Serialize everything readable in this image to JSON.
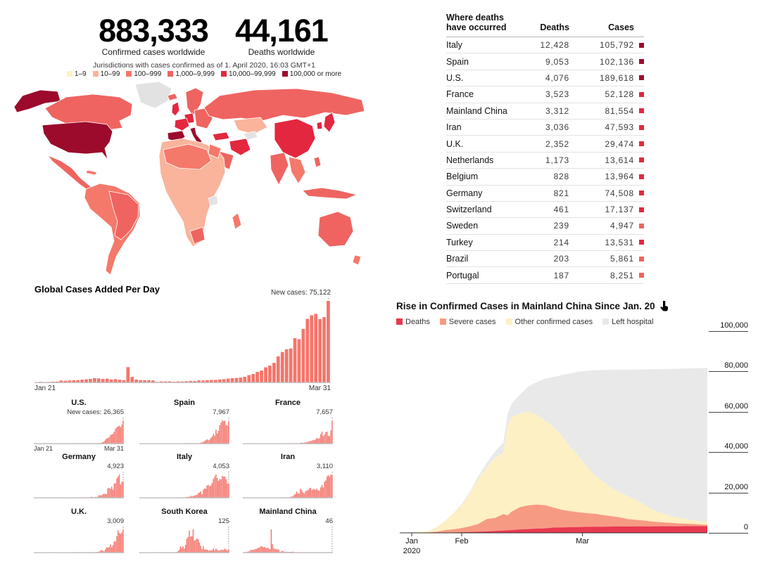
{
  "stats": {
    "confirmed": {
      "value": "883,333",
      "label": "Confirmed cases worldwide"
    },
    "deaths": {
      "value": "44,161",
      "label": "Deaths worldwide"
    }
  },
  "map": {
    "note": "Jurisdictions with cases confirmed as of 1. April 2020, 16:03 GMT+1",
    "no_data_color": "#e2e2e2",
    "legend": [
      {
        "label": "1–9",
        "color": "#fdf2c8"
      },
      {
        "label": "10–99",
        "color": "#f9b49b"
      },
      {
        "label": "100–999",
        "color": "#f4796b"
      },
      {
        "label": "1,000–9,999",
        "color": "#ef6460"
      },
      {
        "label": "10,000–99,999",
        "color": "#e3273f"
      },
      {
        "label": "100,000 or more",
        "color": "#9c0b2c"
      }
    ]
  },
  "palette": {
    "bar": "#f4756c",
    "axis": "#c4c4c4",
    "leader": "#8a8a8a"
  },
  "deaths_table": {
    "title_line1": "Where deaths",
    "title_line2": "have occurred",
    "col_deaths": "Deaths",
    "col_cases": "Cases",
    "rows": [
      {
        "country": "Italy",
        "deaths": "12,428",
        "cases": "105,792",
        "bucket": 5
      },
      {
        "country": "Spain",
        "deaths": "9,053",
        "cases": "102,136",
        "bucket": 5
      },
      {
        "country": "U.S.",
        "deaths": "4,076",
        "cases": "189,618",
        "bucket": 5
      },
      {
        "country": "France",
        "deaths": "3,523",
        "cases": "52,128",
        "bucket": 4
      },
      {
        "country": "Mainland China",
        "deaths": "3,312",
        "cases": "81,554",
        "bucket": 4
      },
      {
        "country": "Iran",
        "deaths": "3,036",
        "cases": "47,593",
        "bucket": 4
      },
      {
        "country": "U.K.",
        "deaths": "2,352",
        "cases": "29,474",
        "bucket": 4
      },
      {
        "country": "Netherlands",
        "deaths": "1,173",
        "cases": "13,614",
        "bucket": 4
      },
      {
        "country": "Belgium",
        "deaths": "828",
        "cases": "13,964",
        "bucket": 4
      },
      {
        "country": "Germany",
        "deaths": "821",
        "cases": "74,508",
        "bucket": 4
      },
      {
        "country": "Switzerland",
        "deaths": "461",
        "cases": "17,137",
        "bucket": 4
      },
      {
        "country": "Sweden",
        "deaths": "239",
        "cases": "4,947",
        "bucket": 3
      },
      {
        "country": "Turkey",
        "deaths": "214",
        "cases": "13,531",
        "bucket": 4
      },
      {
        "country": "Brazil",
        "deaths": "203",
        "cases": "5,861",
        "bucket": 3
      },
      {
        "country": "Portugal",
        "deaths": "187",
        "cases": "8,251",
        "bucket": 3
      }
    ]
  },
  "chart_data": [
    {
      "type": "bar",
      "id": "global",
      "title": "Global Cases Added Per Day",
      "annotation": "New cases: 75,122",
      "x_start": "Jan 21",
      "x_end": "Mar 31",
      "values": [
        314,
        581,
        266,
        472,
        698,
        785,
        1781,
        1477,
        1755,
        2005,
        2127,
        2603,
        2836,
        3239,
        3925,
        3721,
        3163,
        3437,
        2676,
        3001,
        2484,
        2022,
        14113,
        5109,
        2672,
        2162,
        2067,
        1998,
        1852,
        516,
        984,
        930,
        1035,
        648,
        988,
        929,
        1126,
        1420,
        1326,
        1850,
        1727,
        2024,
        2227,
        2306,
        2695,
        2995,
        3500,
        3900,
        4100,
        4500,
        5200,
        6700,
        7800,
        9700,
        10900,
        13900,
        15500,
        18000,
        24000,
        28000,
        30500,
        31300,
        40800,
        39800,
        49200,
        58600,
        61900,
        63200,
        58400,
        60100,
        75122
      ]
    },
    {
      "type": "bar",
      "id": "us",
      "title": "U.S.",
      "annotation": "New cases: 26,365",
      "x_start": "Jan 21",
      "x_end": "Mar 31",
      "values": [
        1,
        0,
        1,
        0,
        1,
        2,
        0,
        1,
        1,
        1,
        2,
        1,
        0,
        2,
        1,
        0,
        1,
        1,
        0,
        1,
        2,
        1,
        0,
        1,
        1,
        1,
        0,
        2,
        1,
        4,
        0,
        6,
        8,
        5,
        3,
        8,
        10,
        15,
        6,
        24,
        20,
        25,
        33,
        77,
        107,
        95,
        213,
        218,
        292,
        281,
        420,
        611,
        771,
        1018,
        1708,
        2526,
        4297,
        5594,
        6349,
        7304,
        9431,
        10301,
        11031,
        13525,
        16916,
        18691,
        19452,
        20342,
        18900,
        21700,
        26365
      ]
    },
    {
      "type": "bar",
      "id": "spain",
      "title": "Spain",
      "annotation": "7,967",
      "values": [
        0,
        0,
        0,
        0,
        0,
        0,
        0,
        0,
        0,
        0,
        0,
        1,
        0,
        0,
        0,
        0,
        0,
        0,
        0,
        0,
        0,
        0,
        0,
        0,
        0,
        0,
        0,
        0,
        0,
        0,
        0,
        0,
        0,
        0,
        2,
        8,
        13,
        27,
        34,
        49,
        36,
        30,
        37,
        57,
        60,
        119,
        117,
        174,
        373,
        400,
        615,
        869,
        1227,
        1522,
        1159,
        1438,
        1987,
        2538,
        3431,
        2833,
        4946,
        3646,
        4517,
        6584,
        7457,
        8271,
        7933,
        8189,
        6549,
        6398,
        7967
      ]
    },
    {
      "type": "bar",
      "id": "france",
      "title": "France",
      "annotation": "7,657",
      "values": [
        0,
        0,
        0,
        3,
        2,
        0,
        1,
        0,
        0,
        0,
        0,
        1,
        0,
        0,
        0,
        0,
        0,
        1,
        0,
        0,
        0,
        0,
        0,
        0,
        0,
        0,
        0,
        0,
        0,
        0,
        0,
        0,
        0,
        2,
        3,
        2,
        21,
        19,
        43,
        30,
        43,
        61,
        21,
        73,
        138,
        190,
        336,
        177,
        286,
        372,
        497,
        595,
        785,
        838,
        924,
        1210,
        1097,
        1404,
        1861,
        1617,
        1847,
        3176,
        3922,
        2446,
        2931,
        3809,
        3922,
        2599,
        2395,
        4376,
        7657
      ]
    },
    {
      "type": "bar",
      "id": "germany",
      "title": "Germany",
      "annotation": "4,923",
      "values": [
        0,
        0,
        0,
        0,
        0,
        0,
        1,
        2,
        1,
        0,
        1,
        2,
        0,
        1,
        1,
        1,
        0,
        1,
        0,
        0,
        1,
        0,
        0,
        1,
        0,
        0,
        0,
        2,
        0,
        0,
        0,
        0,
        0,
        2,
        2,
        2,
        3,
        9,
        27,
        23,
        29,
        28,
        39,
        66,
        138,
        284,
        163,
        55,
        237,
        157,
        271,
        802,
        693,
        733,
        1043,
        1174,
        1144,
        1042,
        2801,
        2958,
        2705,
        3311,
        2365,
        4183,
        4337,
        5780,
        6294,
        6922,
        3965,
        4751,
        4923
      ]
    },
    {
      "type": "bar",
      "id": "italy",
      "title": "Italy",
      "annotation": "4,053",
      "values": [
        0,
        0,
        0,
        0,
        0,
        0,
        0,
        0,
        0,
        2,
        1,
        0,
        0,
        0,
        0,
        0,
        0,
        0,
        0,
        0,
        0,
        0,
        0,
        0,
        0,
        0,
        0,
        0,
        0,
        0,
        0,
        17,
        42,
        93,
        74,
        93,
        131,
        202,
        233,
        240,
        566,
        342,
        466,
        587,
        769,
        778,
        1247,
        1492,
        1797,
        977,
        2313,
        2651,
        2547,
        3497,
        3590,
        3233,
        3526,
        4207,
        5322,
        5986,
        6557,
        5560,
        4789,
        5249,
        5210,
        6153,
        5959,
        5974,
        5217,
        4050,
        4053
      ]
    },
    {
      "type": "bar",
      "id": "iran",
      "title": "Iran",
      "annotation": "3,110",
      "values": [
        0,
        0,
        0,
        0,
        0,
        0,
        0,
        0,
        0,
        0,
        0,
        0,
        0,
        0,
        0,
        0,
        0,
        0,
        0,
        0,
        0,
        0,
        0,
        0,
        0,
        0,
        0,
        0,
        0,
        0,
        2,
        3,
        10,
        15,
        18,
        34,
        44,
        106,
        143,
        205,
        385,
        523,
        835,
        586,
        591,
        1234,
        1076,
        743,
        595,
        881,
        958,
        1075,
        1289,
        1365,
        1053,
        1178,
        1192,
        1046,
        1237,
        1028,
        966,
        1411,
        1762,
        1411,
        2206,
        2389,
        2926,
        3076,
        2901,
        3186,
        3110
      ]
    },
    {
      "type": "bar",
      "id": "uk",
      "title": "U.K.",
      "annotation": "3,009",
      "values": [
        0,
        0,
        0,
        0,
        0,
        0,
        0,
        0,
        0,
        0,
        2,
        0,
        0,
        1,
        0,
        0,
        0,
        1,
        0,
        0,
        0,
        0,
        0,
        0,
        0,
        0,
        0,
        0,
        0,
        3,
        0,
        2,
        0,
        4,
        1,
        5,
        3,
        13,
        4,
        11,
        12,
        4,
        12,
        34,
        29,
        48,
        45,
        69,
        43,
        62,
        77,
        130,
        208,
        342,
        251,
        152,
        407,
        680,
        643,
        714,
        1035,
        665,
        967,
        1427,
        1452,
        2129,
        2885,
        2546,
        2433,
        2619,
        3009
      ]
    },
    {
      "type": "bar",
      "id": "south_korea",
      "title": "South Korea",
      "annotation": "125",
      "values": [
        1,
        0,
        0,
        1,
        0,
        0,
        0,
        0,
        0,
        0,
        1,
        0,
        2,
        0,
        1,
        0,
        3,
        0,
        2,
        1,
        2,
        0,
        1,
        1,
        2,
        0,
        0,
        1,
        1,
        20,
        53,
        100,
        229,
        169,
        231,
        144,
        284,
        505,
        571,
        813,
        586,
        599,
        851,
        435,
        467,
        518,
        483,
        367,
        248,
        131,
        242,
        114,
        110,
        107,
        76,
        74,
        84,
        93,
        152,
        87,
        147,
        98,
        64,
        76,
        100,
        104,
        91,
        146,
        105,
        78,
        125
      ]
    },
    {
      "type": "bar",
      "id": "mainland_china",
      "title": "Mainland China",
      "annotation": "46",
      "values": [
        149,
        131,
        259,
        444,
        688,
        769,
        1771,
        1459,
        1737,
        1981,
        2099,
        2589,
        2825,
        3235,
        3884,
        3694,
        3143,
        3385,
        2652,
        2973,
        2467,
        2015,
        14108,
        5090,
        2641,
        2008,
        2048,
        1888,
        1749,
        391,
        889,
        823,
        648,
        214,
        508,
        406,
        433,
        327,
        427,
        573,
        202,
        125,
        119,
        139,
        143,
        99,
        44,
        40,
        19,
        24,
        15,
        20,
        11,
        20,
        16,
        21,
        13,
        34,
        39,
        41,
        46,
        39,
        78,
        47,
        67,
        55,
        54,
        45,
        31,
        48,
        46
      ]
    },
    {
      "type": "area",
      "id": "china_rise",
      "title": "Rise in Confirmed Cases in Mainland China Since Jan. 20",
      "legend": [
        {
          "key": "deaths",
          "label": "Deaths",
          "color": "#e8384f"
        },
        {
          "key": "severe",
          "label": "Severe cases",
          "color": "#f79a84"
        },
        {
          "key": "other",
          "label": "Other confirmed cases",
          "color": "#fdf0c4"
        },
        {
          "key": "left_hospital",
          "label": "Left hospital",
          "color": "#e9e9e9"
        }
      ],
      "ylim": [
        0,
        100000
      ],
      "y_ticks": [
        {
          "label": "100,000",
          "value": 100000
        },
        {
          "label": "80,000",
          "value": 80000
        },
        {
          "label": "60,000",
          "value": 60000
        },
        {
          "label": "40,000",
          "value": 40000
        },
        {
          "label": "20,000",
          "value": 20000
        },
        {
          "label": "0",
          "value": 0
        }
      ],
      "x_ticks": [
        {
          "label": "Jan",
          "sublabel": "2020",
          "day": 0
        },
        {
          "label": "Feb",
          "sublabel": "",
          "day": 12
        },
        {
          "label": "Mar",
          "sublabel": "",
          "day": 41
        }
      ],
      "days": [
        0,
        2,
        4,
        6,
        8,
        10,
        12,
        14,
        16,
        18,
        20,
        22,
        23,
        24,
        26,
        28,
        30,
        32,
        34,
        36,
        38,
        40,
        42,
        44,
        46,
        48,
        50,
        52,
        54,
        56,
        58,
        60,
        62,
        64,
        66,
        68,
        70,
        71
      ],
      "series": {
        "total": [
          278,
          547,
          916,
          2737,
          5970,
          9658,
          14380,
          20438,
          28018,
          34546,
          40171,
          44653,
          58761,
          63851,
          68500,
          72436,
          74576,
          76288,
          77150,
          78064,
          78824,
          79824,
          80151,
          80409,
          80651,
          80735,
          80778,
          80813,
          80844,
          80881,
          80928,
          81008,
          81093,
          81218,
          81340,
          81439,
          81518,
          81554
        ],
        "deaths": [
          6,
          17,
          26,
          80,
          132,
          213,
          304,
          425,
          563,
          722,
          908,
          1113,
          1259,
          1380,
          1665,
          1868,
          2118,
          2236,
          2592,
          2715,
          2788,
          2870,
          2943,
          3012,
          3070,
          3119,
          3158,
          3176,
          3199,
          3226,
          3245,
          3255,
          3270,
          3281,
          3292,
          3300,
          3305,
          3312
        ],
        "severe": [
          51,
          95,
          170,
          461,
          1239,
          1527,
          2110,
          2788,
          3859,
          6101,
          6484,
          8204,
          7333,
          9126,
          11053,
          11741,
          11864,
          11477,
          9915,
          8752,
          7952,
          7365,
          6806,
          6416,
          5737,
          5111,
          4492,
          3610,
          3226,
          2830,
          2314,
          1963,
          1749,
          1399,
          1235,
          1034,
          742,
          633
        ],
        "left_hospital": [
          28,
          28,
          36,
          49,
          103,
          171,
          328,
          632,
          1153,
          2050,
          3281,
          4740,
          5911,
          6723,
          9419,
          12552,
          16155,
          20659,
          24734,
          29745,
          36117,
          41625,
          47204,
          52045,
          55404,
          58600,
          60810,
          62793,
          64632,
          67017,
          69601,
          71244,
          72703,
          73650,
          74588,
          75448,
          76052,
          76238
        ]
      }
    }
  ]
}
